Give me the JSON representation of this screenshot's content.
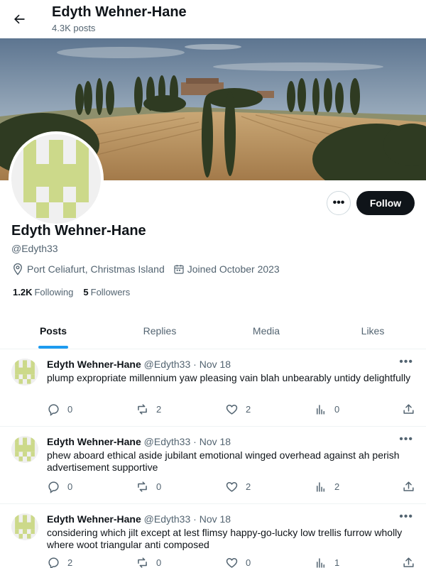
{
  "header": {
    "title": "Edyth Wehner-Hane",
    "post_count": "4.3K posts"
  },
  "profile": {
    "name": "Edyth Wehner-Hane",
    "handle": "@Edyth33",
    "location": "Port Celiafurt, Christmas Island",
    "joined": "Joined October 2023",
    "following_count": "1.2K",
    "following_label": "Following",
    "followers_count": "5",
    "followers_label": "Followers",
    "follow_label": "Follow",
    "more_label": "•••"
  },
  "tabs": [
    {
      "label": "Posts",
      "active": true
    },
    {
      "label": "Replies",
      "active": false
    },
    {
      "label": "Media",
      "active": false
    },
    {
      "label": "Likes",
      "active": false
    }
  ],
  "posts": [
    {
      "name": "Edyth Wehner-Hane",
      "handle": "@Edyth33",
      "separator": "·",
      "date": "Nov 18",
      "text": "plump expropriate millennium yaw pleasing vain blah unbearably untidy delightfully",
      "replies": "0",
      "reposts": "2",
      "likes": "2",
      "views": "0"
    },
    {
      "name": "Edyth Wehner-Hane",
      "handle": "@Edyth33",
      "separator": "·",
      "date": "Nov 18",
      "text": "phew aboard ethical aside jubilant emotional winged overhead against ah perish advertisement supportive",
      "replies": "0",
      "reposts": "0",
      "likes": "2",
      "views": "2"
    },
    {
      "name": "Edyth Wehner-Hane",
      "handle": "@Edyth33",
      "separator": "·",
      "date": "Nov 18",
      "text": "considering which jilt except at lest flimsy happy-go-lucky low trellis furrow wholly where woot triangular anti composed",
      "replies": "2",
      "reposts": "0",
      "likes": "0",
      "views": "1"
    }
  ],
  "post_menu_label": "•••",
  "colors": {
    "accent": "#1d9bf0",
    "avatar_pattern": "#ccd98a",
    "text": "#0f1419",
    "muted": "#536471"
  },
  "icons": [
    "back-arrow-icon",
    "location-icon",
    "calendar-icon",
    "reply-icon",
    "repost-icon",
    "like-icon",
    "views-icon",
    "share-icon"
  ]
}
